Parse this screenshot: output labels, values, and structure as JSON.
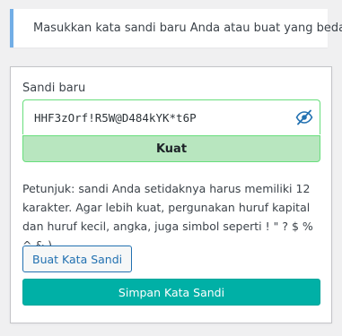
{
  "notice": {
    "message": "Masukkan kata sandi baru Anda atau buat yang beda.",
    "accent_color": "#72aee6"
  },
  "form": {
    "password_label": "Sandi baru",
    "password_value": "HHF3zOrf!R5W@D484kYK*t6P",
    "toggle_icon": "eye-slash-icon",
    "strength_text": "Kuat",
    "strength_color": "#b8e6bf",
    "hint_text": "Petunjuk: sandi Anda setidaknya harus memiliki 12 karakter. Agar lebih kuat, pergunakan huruf kapital dan huruf kecil, angka, juga simbol seperti ! \" ? $ % ^ & ).",
    "generate_button": "Buat Kata Sandi",
    "save_button": "Simpan Kata Sandi",
    "primary_color": "#00b0a6",
    "link_color": "#2271b1"
  }
}
